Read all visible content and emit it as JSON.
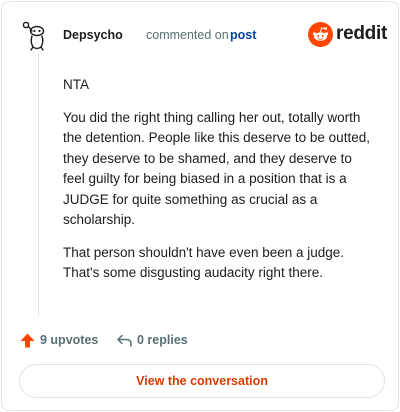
{
  "comment": {
    "author": "Depsycho",
    "action_text": "commented on",
    "link_text": "post",
    "paragraphs": [
      "NTA",
      "You did the right thing calling her out, totally worth the detention. People like this deserve to be outted, they deserve to be shamed, and they deserve to feel guilty for being biased in a position that is a JUDGE for quite something as crucial as a scholarship.",
      "That person shouldn't have even been a judge. That's some disgusting audacity right there."
    ]
  },
  "brand": {
    "name": "reddit",
    "accent_color": "#ff4500"
  },
  "stats": {
    "upvotes_label": "9 upvotes",
    "replies_label": "0 replies",
    "upvote_icon": "upvote-arrow-icon",
    "reply_icon": "reply-arrow-icon"
  },
  "cta": {
    "label": "View the conversation"
  }
}
